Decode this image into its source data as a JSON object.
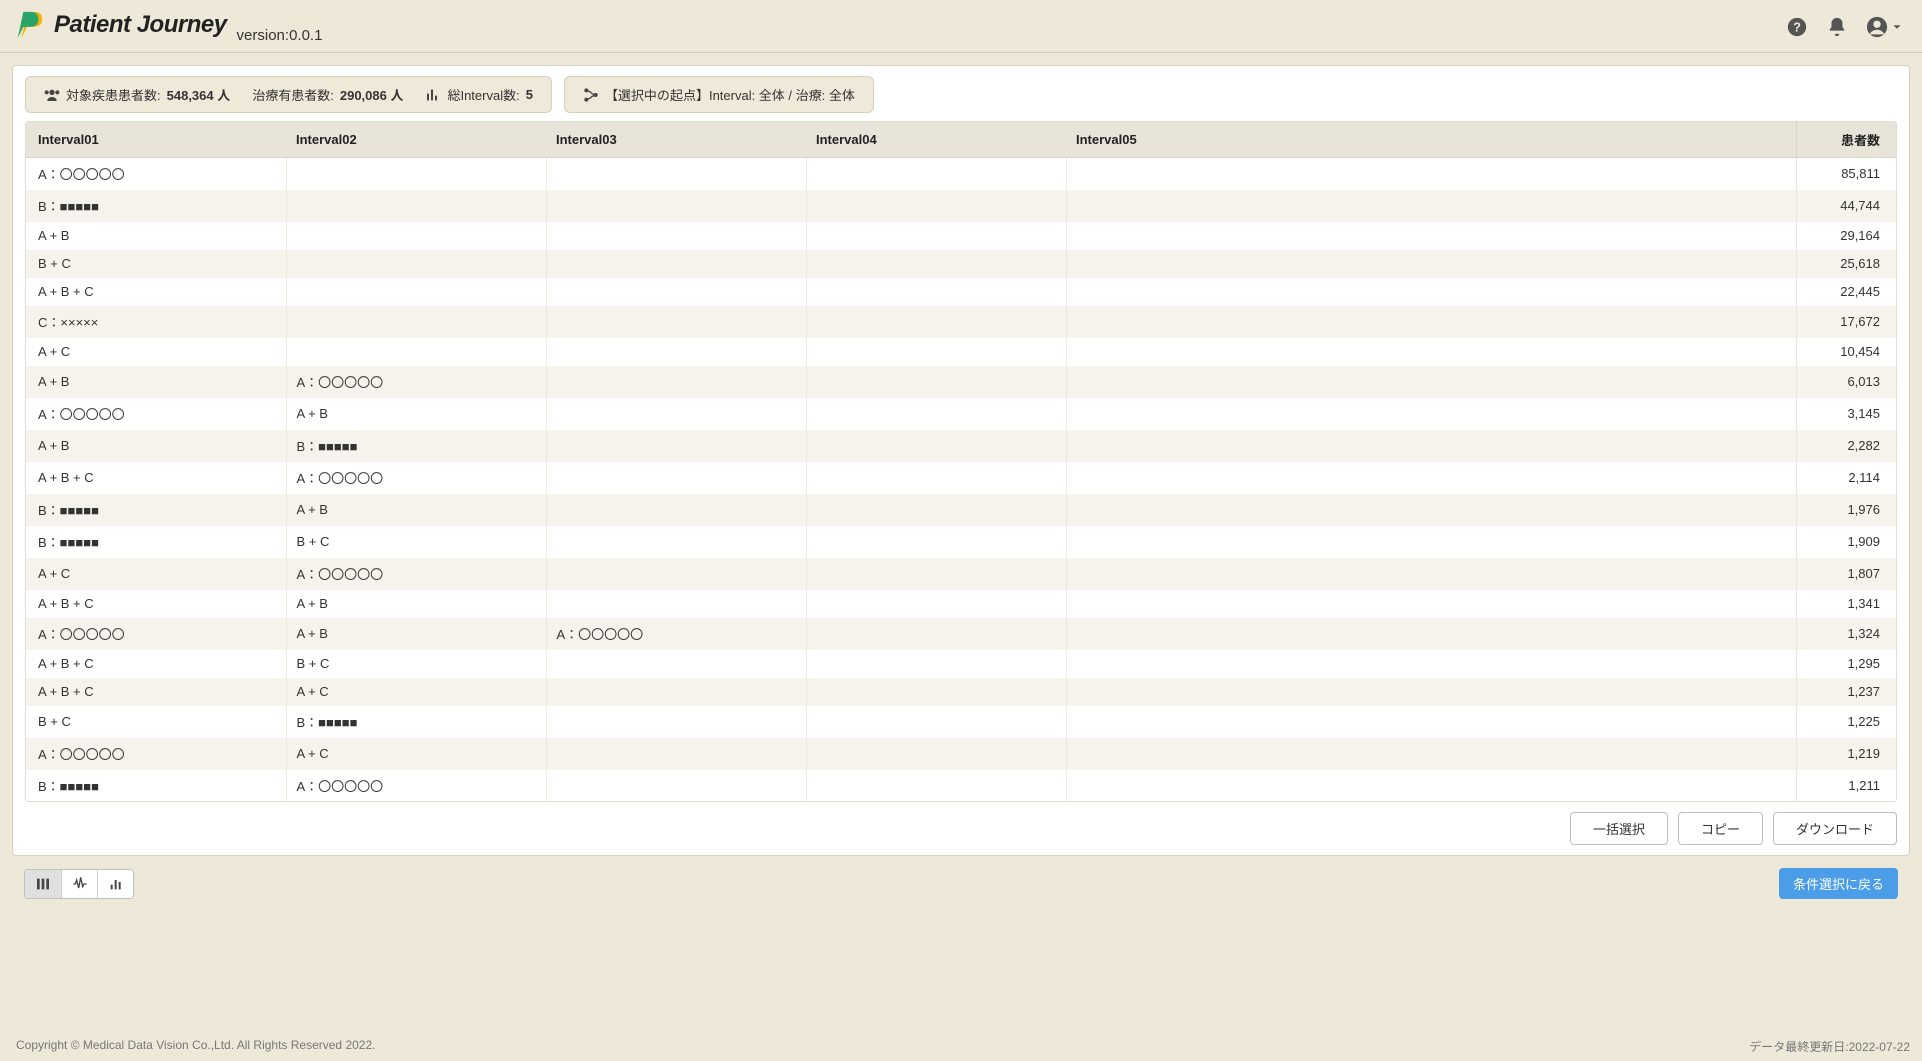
{
  "header": {
    "app_name": "Patient Journey",
    "version_label": "version:0.0.1"
  },
  "stats": {
    "target_label": "対象疾患患者数:",
    "target_value": "548,364 人",
    "treated_label": "治療有患者数:",
    "treated_value": "290,086 人",
    "interval_label": "総Interval数:",
    "interval_value": "5",
    "origin_label": "【選択中の起点】Interval: 全体 / 治療: 全体"
  },
  "columns": {
    "i1": "Interval01",
    "i2": "Interval02",
    "i3": "Interval03",
    "i4": "Interval04",
    "i5": "Interval05",
    "count": "患者数"
  },
  "rows": [
    {
      "i1": "A：〇〇〇〇〇",
      "i2": "",
      "i3": "",
      "i4": "",
      "i5": "",
      "count": "85,811"
    },
    {
      "i1": "B：■■■■■",
      "i2": "",
      "i3": "",
      "i4": "",
      "i5": "",
      "count": "44,744"
    },
    {
      "i1": "A + B",
      "i2": "",
      "i3": "",
      "i4": "",
      "i5": "",
      "count": "29,164"
    },
    {
      "i1": "B + C",
      "i2": "",
      "i3": "",
      "i4": "",
      "i5": "",
      "count": "25,618"
    },
    {
      "i1": "A + B + C",
      "i2": "",
      "i3": "",
      "i4": "",
      "i5": "",
      "count": "22,445"
    },
    {
      "i1": "C：×××××",
      "i2": "",
      "i3": "",
      "i4": "",
      "i5": "",
      "count": "17,672"
    },
    {
      "i1": "A + C",
      "i2": "",
      "i3": "",
      "i4": "",
      "i5": "",
      "count": "10,454"
    },
    {
      "i1": "A + B",
      "i2": "A：〇〇〇〇〇",
      "i3": "",
      "i4": "",
      "i5": "",
      "count": "6,013"
    },
    {
      "i1": "A：〇〇〇〇〇",
      "i2": "A + B",
      "i3": "",
      "i4": "",
      "i5": "",
      "count": "3,145"
    },
    {
      "i1": "A + B",
      "i2": "B：■■■■■",
      "i3": "",
      "i4": "",
      "i5": "",
      "count": "2,282"
    },
    {
      "i1": "A + B + C",
      "i2": "A：〇〇〇〇〇",
      "i3": "",
      "i4": "",
      "i5": "",
      "count": "2,114"
    },
    {
      "i1": "B：■■■■■",
      "i2": "A + B",
      "i3": "",
      "i4": "",
      "i5": "",
      "count": "1,976"
    },
    {
      "i1": "B：■■■■■",
      "i2": "B + C",
      "i3": "",
      "i4": "",
      "i5": "",
      "count": "1,909"
    },
    {
      "i1": "A + C",
      "i2": "A：〇〇〇〇〇",
      "i3": "",
      "i4": "",
      "i5": "",
      "count": "1,807"
    },
    {
      "i1": "A + B + C",
      "i2": "A + B",
      "i3": "",
      "i4": "",
      "i5": "",
      "count": "1,341"
    },
    {
      "i1": "A：〇〇〇〇〇",
      "i2": "A + B",
      "i3": "A：〇〇〇〇〇",
      "i4": "",
      "i5": "",
      "count": "1,324"
    },
    {
      "i1": "A + B + C",
      "i2": "B + C",
      "i3": "",
      "i4": "",
      "i5": "",
      "count": "1,295"
    },
    {
      "i1": "A + B + C",
      "i2": "A + C",
      "i3": "",
      "i4": "",
      "i5": "",
      "count": "1,237"
    },
    {
      "i1": "B + C",
      "i2": "B：■■■■■",
      "i3": "",
      "i4": "",
      "i5": "",
      "count": "1,225"
    },
    {
      "i1": "A：〇〇〇〇〇",
      "i2": "A + C",
      "i3": "",
      "i4": "",
      "i5": "",
      "count": "1,219"
    },
    {
      "i1": "B：■■■■■",
      "i2": "A：〇〇〇〇〇",
      "i3": "",
      "i4": "",
      "i5": "",
      "count": "1,211"
    }
  ],
  "actions": {
    "select_all": "一括選択",
    "copy": "コピー",
    "download": "ダウンロード",
    "back": "条件選択に戻る"
  },
  "footer": {
    "copyright": "Copyright © Medical Data Vision Co.,Ltd. All Rights Reserved 2022.",
    "updated": "データ最終更新日:2022-07-22"
  }
}
